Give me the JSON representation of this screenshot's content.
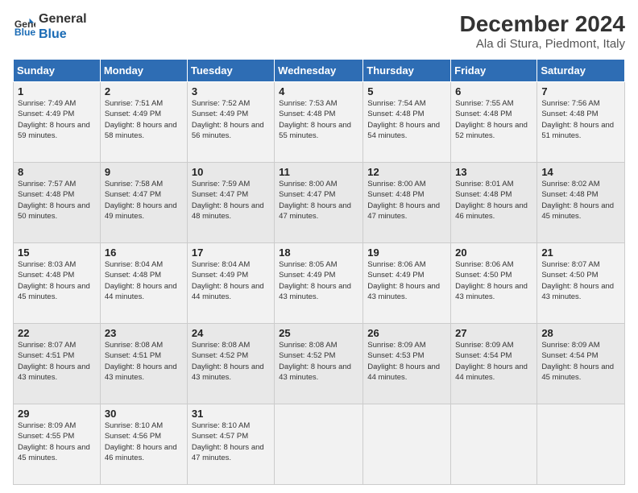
{
  "header": {
    "logo_line1": "General",
    "logo_line2": "Blue",
    "main_title": "December 2024",
    "subtitle": "Ala di Stura, Piedmont, Italy"
  },
  "days_of_week": [
    "Sunday",
    "Monday",
    "Tuesday",
    "Wednesday",
    "Thursday",
    "Friday",
    "Saturday"
  ],
  "weeks": [
    [
      {
        "day": 1,
        "rise": "7:49 AM",
        "set": "4:49 PM",
        "hours": "8 hours and 59 minutes."
      },
      {
        "day": 2,
        "rise": "7:51 AM",
        "set": "4:49 PM",
        "hours": "8 hours and 58 minutes."
      },
      {
        "day": 3,
        "rise": "7:52 AM",
        "set": "4:49 PM",
        "hours": "8 hours and 56 minutes."
      },
      {
        "day": 4,
        "rise": "7:53 AM",
        "set": "4:48 PM",
        "hours": "8 hours and 55 minutes."
      },
      {
        "day": 5,
        "rise": "7:54 AM",
        "set": "4:48 PM",
        "hours": "8 hours and 54 minutes."
      },
      {
        "day": 6,
        "rise": "7:55 AM",
        "set": "4:48 PM",
        "hours": "8 hours and 52 minutes."
      },
      {
        "day": 7,
        "rise": "7:56 AM",
        "set": "4:48 PM",
        "hours": "8 hours and 51 minutes."
      }
    ],
    [
      {
        "day": 8,
        "rise": "7:57 AM",
        "set": "4:48 PM",
        "hours": "8 hours and 50 minutes."
      },
      {
        "day": 9,
        "rise": "7:58 AM",
        "set": "4:47 PM",
        "hours": "8 hours and 49 minutes."
      },
      {
        "day": 10,
        "rise": "7:59 AM",
        "set": "4:47 PM",
        "hours": "8 hours and 48 minutes."
      },
      {
        "day": 11,
        "rise": "8:00 AM",
        "set": "4:47 PM",
        "hours": "8 hours and 47 minutes."
      },
      {
        "day": 12,
        "rise": "8:00 AM",
        "set": "4:48 PM",
        "hours": "8 hours and 47 minutes."
      },
      {
        "day": 13,
        "rise": "8:01 AM",
        "set": "4:48 PM",
        "hours": "8 hours and 46 minutes."
      },
      {
        "day": 14,
        "rise": "8:02 AM",
        "set": "4:48 PM",
        "hours": "8 hours and 45 minutes."
      }
    ],
    [
      {
        "day": 15,
        "rise": "8:03 AM",
        "set": "4:48 PM",
        "hours": "8 hours and 45 minutes."
      },
      {
        "day": 16,
        "rise": "8:04 AM",
        "set": "4:48 PM",
        "hours": "8 hours and 44 minutes."
      },
      {
        "day": 17,
        "rise": "8:04 AM",
        "set": "4:49 PM",
        "hours": "8 hours and 44 minutes."
      },
      {
        "day": 18,
        "rise": "8:05 AM",
        "set": "4:49 PM",
        "hours": "8 hours and 43 minutes."
      },
      {
        "day": 19,
        "rise": "8:06 AM",
        "set": "4:49 PM",
        "hours": "8 hours and 43 minutes."
      },
      {
        "day": 20,
        "rise": "8:06 AM",
        "set": "4:50 PM",
        "hours": "8 hours and 43 minutes."
      },
      {
        "day": 21,
        "rise": "8:07 AM",
        "set": "4:50 PM",
        "hours": "8 hours and 43 minutes."
      }
    ],
    [
      {
        "day": 22,
        "rise": "8:07 AM",
        "set": "4:51 PM",
        "hours": "8 hours and 43 minutes."
      },
      {
        "day": 23,
        "rise": "8:08 AM",
        "set": "4:51 PM",
        "hours": "8 hours and 43 minutes."
      },
      {
        "day": 24,
        "rise": "8:08 AM",
        "set": "4:52 PM",
        "hours": "8 hours and 43 minutes."
      },
      {
        "day": 25,
        "rise": "8:08 AM",
        "set": "4:52 PM",
        "hours": "8 hours and 43 minutes."
      },
      {
        "day": 26,
        "rise": "8:09 AM",
        "set": "4:53 PM",
        "hours": "8 hours and 44 minutes."
      },
      {
        "day": 27,
        "rise": "8:09 AM",
        "set": "4:54 PM",
        "hours": "8 hours and 44 minutes."
      },
      {
        "day": 28,
        "rise": "8:09 AM",
        "set": "4:54 PM",
        "hours": "8 hours and 45 minutes."
      }
    ],
    [
      {
        "day": 29,
        "rise": "8:09 AM",
        "set": "4:55 PM",
        "hours": "8 hours and 45 minutes."
      },
      {
        "day": 30,
        "rise": "8:10 AM",
        "set": "4:56 PM",
        "hours": "8 hours and 46 minutes."
      },
      {
        "day": 31,
        "rise": "8:10 AM",
        "set": "4:57 PM",
        "hours": "8 hours and 47 minutes."
      },
      null,
      null,
      null,
      null
    ]
  ]
}
